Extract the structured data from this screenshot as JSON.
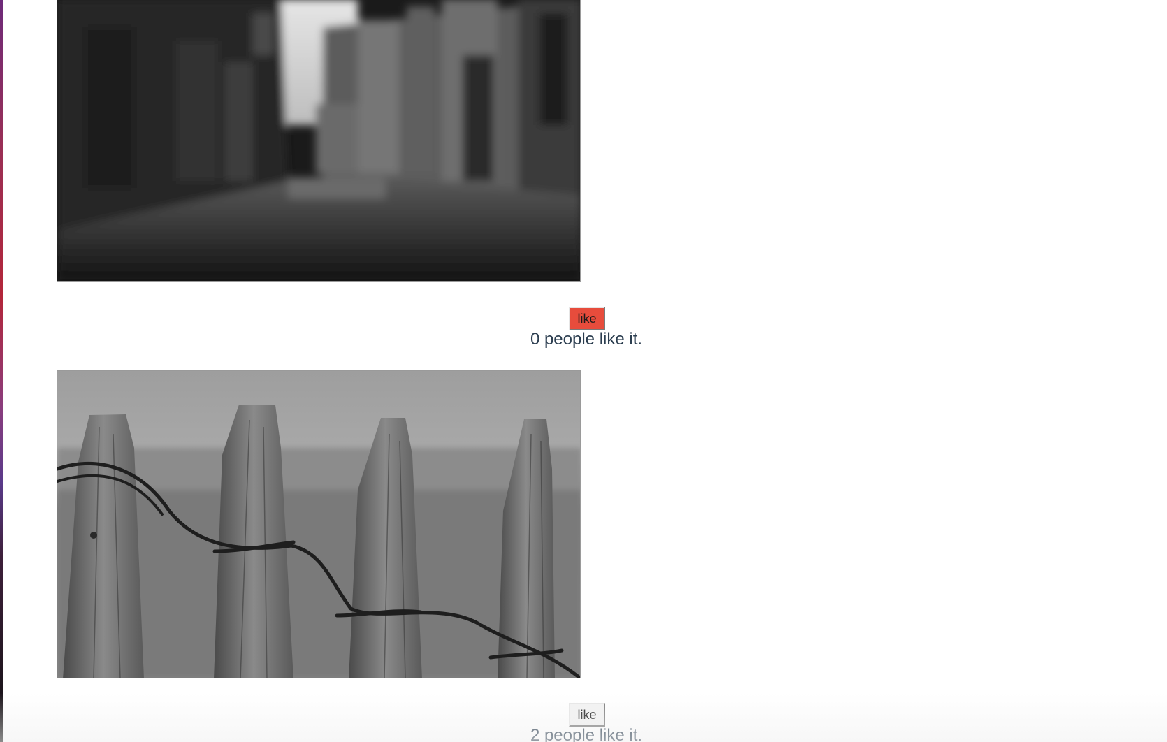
{
  "posts": [
    {
      "image_description": "blurred street",
      "like_label": "like",
      "like_active": true,
      "likes_text": "0 people like it."
    },
    {
      "image_description": "wooden fence posts with rope",
      "like_label": "like",
      "like_active": false,
      "likes_text": "2 people like it."
    }
  ],
  "colors": {
    "like_active_bg": "#e74c3c",
    "like_text": "#2c3e50"
  }
}
